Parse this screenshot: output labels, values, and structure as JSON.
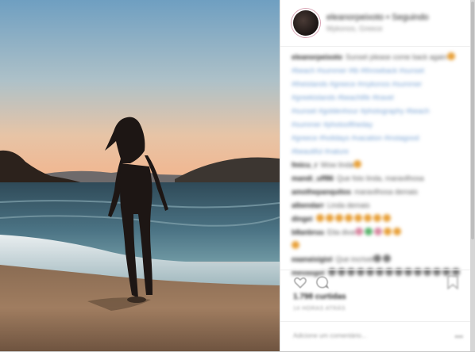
{
  "post": {
    "username": "eleanorpeixoto",
    "follow_label": "• Seguindo",
    "location": "Mykonos, Greece"
  },
  "comments": [
    {
      "user": "eleanorpeixoto",
      "text": "Sunset please come back again",
      "emoji": [
        "o"
      ]
    },
    {
      "user": "",
      "text": "#beach #summer #tb #throwback #sunset",
      "tag": true
    },
    {
      "user": "",
      "text": "#theislands #greece #mykonos #summer",
      "tag": true
    },
    {
      "user": "",
      "text": "#greekislands #beachlife #travel",
      "tag": true
    },
    {
      "user": "",
      "text": "#sunset #goldenhour #photography #beach",
      "tag": true
    },
    {
      "user": "",
      "text": "#summer #photooftheday",
      "tag": true
    },
    {
      "user": "",
      "text": "#greece #holidays #vacation #instagood",
      "tag": true
    },
    {
      "user": "",
      "text": "#beautiful #nature",
      "tag": true
    },
    {
      "user": "fmicu_r",
      "text": "Wow linda",
      "emoji": [
        "o"
      ]
    },
    {
      "user": "mandi_uff86",
      "text": "Que foto linda, maravilhosa",
      "emoji": []
    },
    {
      "user": "amothepanquitos",
      "text": "maravilhosa demais",
      "emoji": []
    },
    {
      "user": "albendarr",
      "text": "Linda demais",
      "emoji": []
    },
    {
      "user": "dingei",
      "text": "",
      "emoji": [
        "o",
        "o",
        "o",
        "o",
        "o",
        "o",
        "o",
        "o"
      ]
    },
    {
      "user": "b8anbruu",
      "text": "Eita diva",
      "emoji": [
        "p",
        "gr",
        "p",
        "o",
        "o"
      ]
    },
    {
      "user": "",
      "text": "",
      "emoji": [
        "o"
      ]
    },
    {
      "user": "eaanaisigiol",
      "text": "Que incrivel",
      "emoji": [
        "g",
        "g"
      ]
    },
    {
      "user": "mevasgol",
      "text": "",
      "emoji": [
        "g",
        "g",
        "g",
        "g",
        "g",
        "g",
        "g",
        "g",
        "g",
        "g",
        "g",
        "g",
        "g",
        "g"
      ]
    }
  ],
  "likes_text": "1.798 curtidas",
  "time_text": "14 HORAS ATRÁS",
  "add_comment_placeholder": "Adicione um comentário...",
  "more_label": "•••"
}
